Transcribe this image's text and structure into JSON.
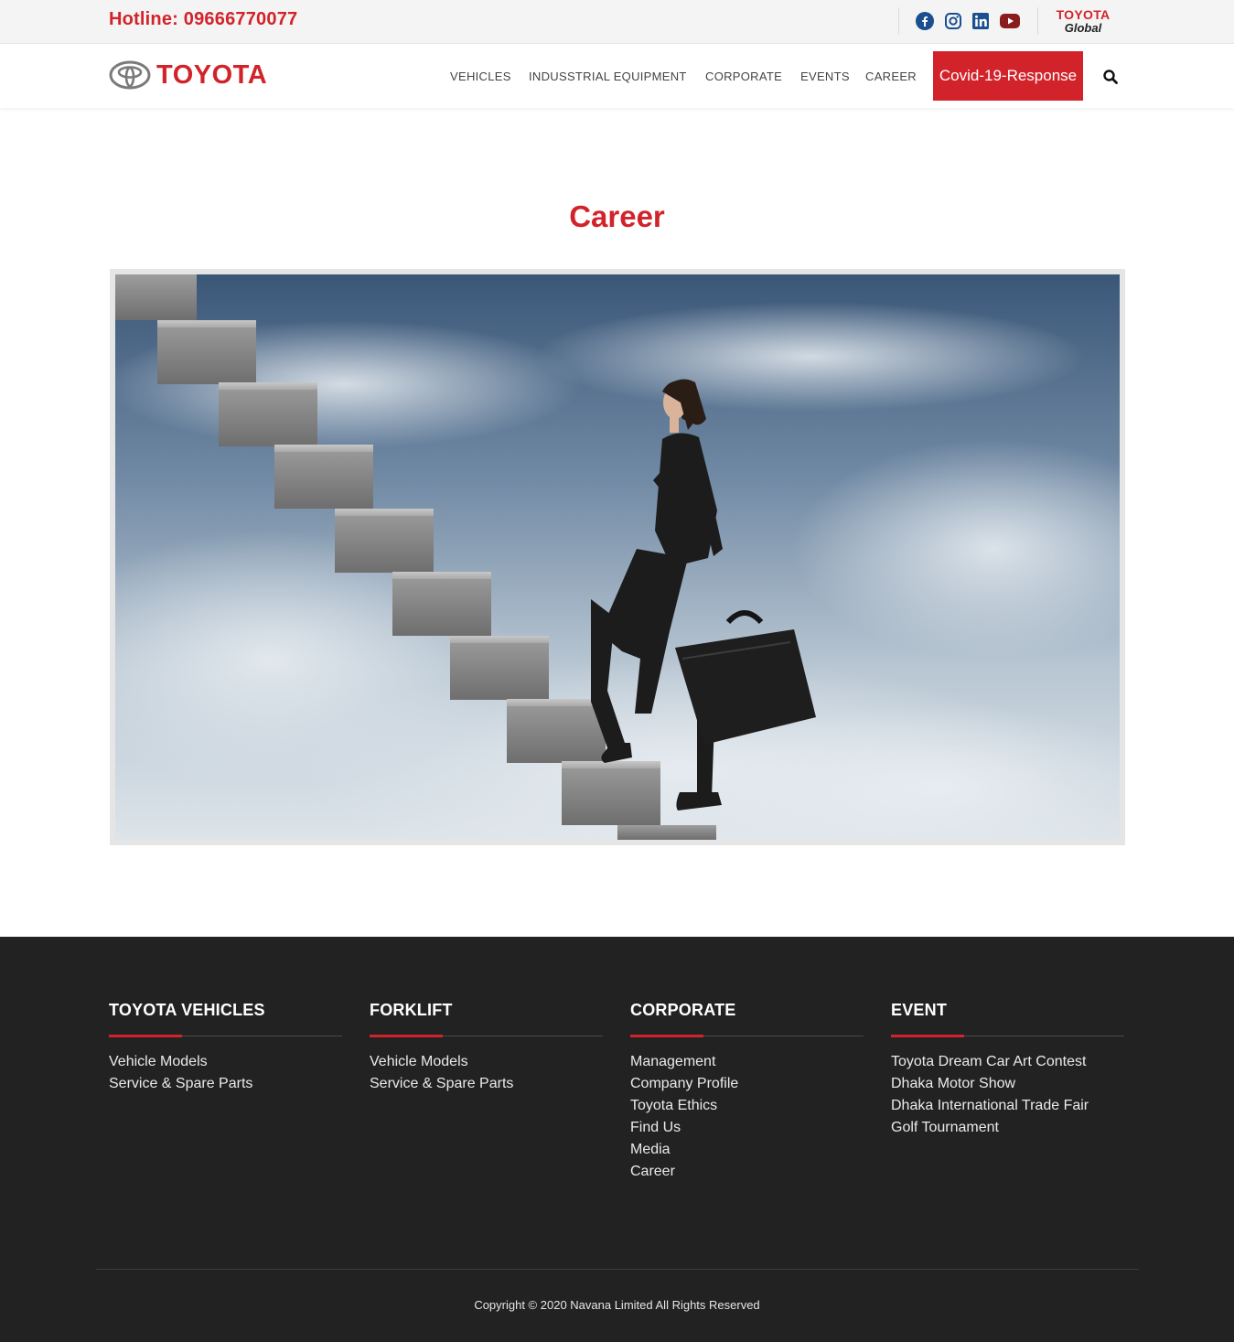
{
  "topbar": {
    "hotline": "Hotline: 09666770077",
    "social": [
      "facebook-icon",
      "instagram-icon",
      "linkedin-icon",
      "youtube-icon"
    ],
    "global_brand": "TOYOTA",
    "global_sub": "Global"
  },
  "header": {
    "logo_text": "TOYOTA",
    "nav": [
      "VEHICLES",
      "INDUSSTRIAL EQUIPMENT",
      "CORPORATE",
      "EVENTS",
      "CAREER"
    ],
    "cta": "Covid-19-Response",
    "search_icon": "search-icon"
  },
  "main": {
    "title": "Career",
    "hero_image": "businesswoman-climbing-stairs-sky"
  },
  "footer": {
    "columns": [
      {
        "heading": "TOYOTA VEHICLES",
        "links": [
          "Vehicle Models",
          "Service & Spare Parts"
        ]
      },
      {
        "heading": "FORKLIFT",
        "links": [
          "Vehicle Models",
          "Service & Spare Parts"
        ]
      },
      {
        "heading": "CORPORATE",
        "links": [
          "Management",
          "Company Profile",
          "Toyota Ethics",
          "Find Us",
          "Media",
          "Career"
        ]
      },
      {
        "heading": "EVENT",
        "links": [
          "Toyota Dream Car Art Contest",
          "Dhaka Motor Show",
          "Dhaka International Trade Fair",
          "Golf Tournament"
        ]
      }
    ],
    "copyright": "Copyright © 2020 Navana Limited All Rights Reserved"
  },
  "colors": {
    "brand_red": "#d2232a",
    "footer_bg": "#222222",
    "topbar_bg": "#f4f4f4"
  }
}
